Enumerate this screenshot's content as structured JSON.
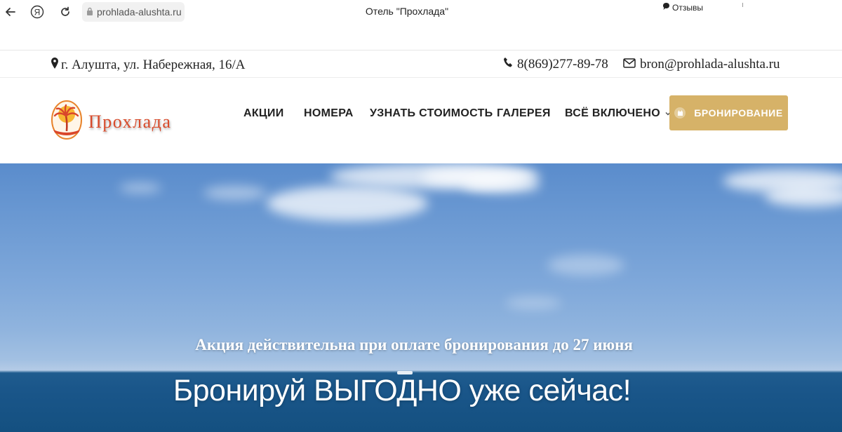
{
  "browser": {
    "url": "prohlada-alushta.ru",
    "tab_title": "Отель \"Прохлада\"",
    "reviews_label": "Отзывы"
  },
  "contacts": {
    "address": "г. Алушта, ул. Набережная, 16/А",
    "phone": "8(869)277-89-78",
    "email": "bron@prohlada-alushta.ru"
  },
  "header": {
    "logo_text": "Прохлада",
    "nav": [
      {
        "label": "АКЦИИ"
      },
      {
        "label": "НОМЕРА"
      },
      {
        "label": "УЗНАТЬ СТОИМОСТЬ"
      },
      {
        "label": "ГАЛЕРЕЯ"
      },
      {
        "label": "ВСЁ ВКЛЮЧЕНО"
      }
    ],
    "booking_label": "БРОНИРОВАНИЕ"
  },
  "hero": {
    "promo": "Акция действительна при оплате бронирования до 27 июня",
    "headline": "Бронируй ВЫГОДНО уже сейчас!"
  },
  "colors": {
    "accent": "#d6b268",
    "logo": "#d94b2b"
  }
}
